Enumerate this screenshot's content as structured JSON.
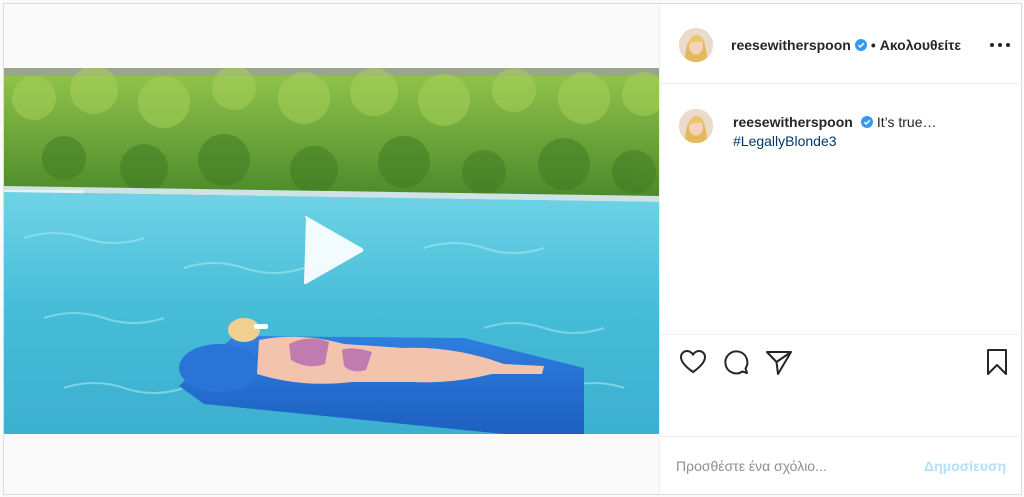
{
  "post": {
    "author": {
      "username": "reesewitherspoon",
      "avatar": "avatar-blonde-woman",
      "verified_icon": "verified-badge-icon"
    },
    "header": {
      "separator": "•",
      "follow_status": "Ακολουθείτε",
      "more_icon": "more-options-icon"
    },
    "caption": {
      "username": "reesewitherspoon",
      "text": "It’s true…",
      "hashtag": "#LegallyBlonde3"
    },
    "media": {
      "type": "video",
      "play_icon": "play-icon"
    },
    "actions": {
      "like_icon": "heart-icon",
      "comment_icon": "comment-bubble-icon",
      "share_icon": "paper-plane-icon",
      "save_icon": "bookmark-icon"
    },
    "comment_box": {
      "placeholder": "Προσθέστε ένα σχόλιο...",
      "submit_label": "Δημοσίευση"
    },
    "colors": {
      "verified": "#3897f0",
      "hashtag": "#00376b",
      "submit_disabled": "#b2dffc",
      "border": "#dbdbdb"
    }
  }
}
